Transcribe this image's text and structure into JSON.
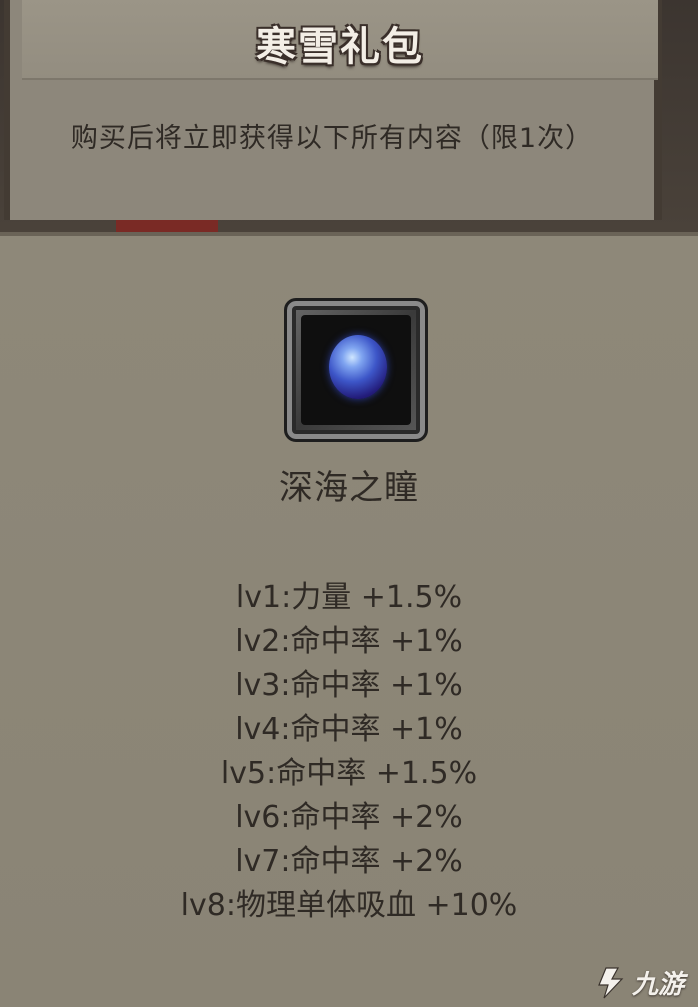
{
  "gift_pack": {
    "title": "寒雪礼包",
    "subtitle": "购买后将立即获得以下所有内容（限1次）"
  },
  "item": {
    "icon": "blue-orb-icon",
    "name": "深海之瞳",
    "stats": [
      "lv1:力量 +1.5%",
      "lv2:命中率 +1%",
      "lv3:命中率 +1%",
      "lv4:命中率 +1%",
      "lv5:命中率 +1.5%",
      "lv6:命中率 +2%",
      "lv7:命中率 +2%",
      "lv8:物理单体吸血 +10%"
    ]
  },
  "watermark": {
    "icon": "jiuyou-logo-icon",
    "text": "九游"
  },
  "colors": {
    "panel_bg": "#8b8678",
    "text_dark": "#2f2a25",
    "title_text": "#f3eee6",
    "frame_dark": "#433b33",
    "orb_blue": "#3d56c8"
  }
}
